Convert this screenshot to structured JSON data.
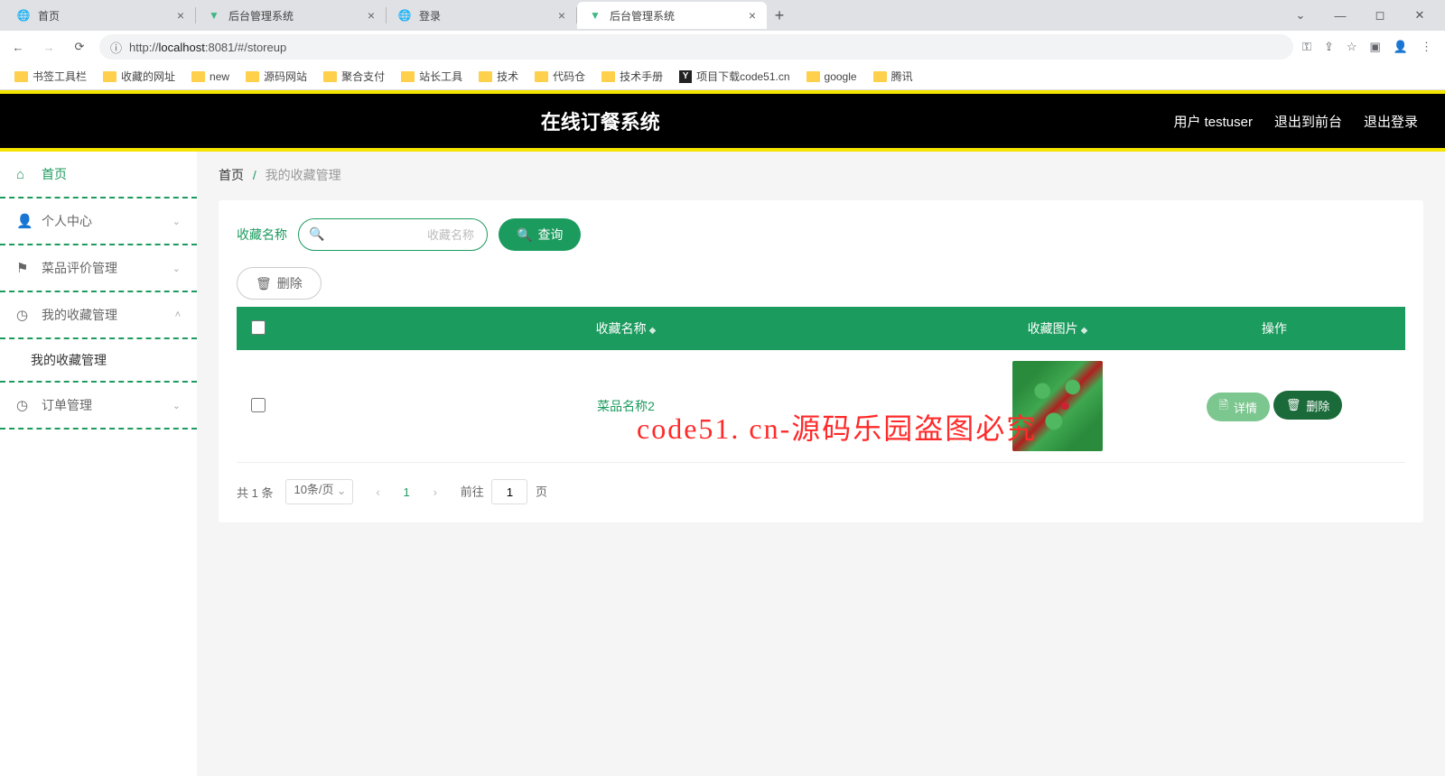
{
  "browser": {
    "tabs": [
      {
        "label": "首页",
        "icon": "globe"
      },
      {
        "label": "后台管理系统",
        "icon": "vue"
      },
      {
        "label": "登录",
        "icon": "globe"
      },
      {
        "label": "后台管理系统",
        "icon": "vue",
        "active": true
      }
    ],
    "url_prefix": "http://",
    "url_host": "localhost",
    "url_rest": ":8081/#/storeup",
    "bookmarks": [
      "书签工具栏",
      "收藏的网址",
      "new",
      "源码网站",
      "聚合支付",
      "站长工具",
      "技术",
      "代码仓",
      "技术手册",
      "项目下载code51.cn",
      "google",
      "腾讯"
    ]
  },
  "header": {
    "title": "在线订餐系统",
    "user_label": "用户 testuser",
    "to_front": "退出到前台",
    "logout": "退出登录"
  },
  "sidebar": {
    "items": [
      {
        "label": "首页",
        "icon": "home",
        "kind": "home"
      },
      {
        "label": "个人中心",
        "icon": "user",
        "chev": "⌄"
      },
      {
        "label": "菜品评价管理",
        "icon": "flag",
        "chev": "⌄"
      },
      {
        "label": "我的收藏管理",
        "icon": "clock",
        "chev": "˄"
      },
      {
        "label": "订单管理",
        "icon": "clock",
        "chev": "⌄"
      }
    ],
    "submenu": "我的收藏管理"
  },
  "breadcrumb": {
    "home": "首页",
    "current": "我的收藏管理"
  },
  "search": {
    "label": "收藏名称",
    "placeholder": "收藏名称",
    "query_btn": "查询"
  },
  "toolbar": {
    "delete_btn": "删除"
  },
  "table": {
    "cols": {
      "name": "收藏名称",
      "image": "收藏图片",
      "ops": "操作"
    },
    "rows": [
      {
        "name": "菜品名称2"
      }
    ],
    "row_btns": {
      "detail": "详情",
      "delete": "删除"
    }
  },
  "pagination": {
    "total_text": "共 1 条",
    "page_size": "10条/页",
    "current": "1",
    "jump_prefix": "前往",
    "jump_value": "1",
    "jump_suffix": "页"
  },
  "watermark": "code51. cn-源码乐园盗图必究"
}
